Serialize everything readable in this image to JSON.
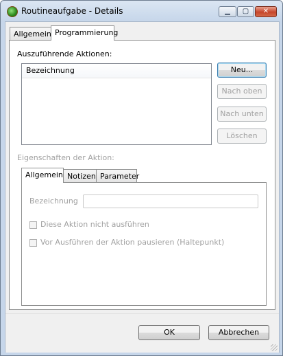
{
  "window": {
    "title": "Routineaufgabe - Details",
    "controls": {
      "minimize": "▁",
      "maximize": "▢",
      "close": "✕"
    }
  },
  "main_tabs": [
    {
      "label": "Allgemein",
      "active": false
    },
    {
      "label": "Programmierung",
      "active": true
    }
  ],
  "actions": {
    "label": "Auszuführende Aktionen:",
    "list_header": "Bezeichnung",
    "items": []
  },
  "buttons": {
    "new": "Neu...",
    "up": "Nach oben",
    "down": "Nach unten",
    "delete": "Löschen"
  },
  "properties": {
    "label": "Eigenschaften der Aktion:",
    "tabs": [
      {
        "label": "Allgemein",
        "active": true
      },
      {
        "label": "Notizen",
        "active": false
      },
      {
        "label": "Parameter",
        "active": false
      }
    ],
    "name_label": "Bezeichnung",
    "name_value": "",
    "checkbox_skip": "Diese Aktion nicht ausführen",
    "checkbox_pause": "Vor Ausführen der Aktion pausieren (Haltepunkt)"
  },
  "dialog_buttons": {
    "ok": "OK",
    "cancel": "Abbrechen"
  },
  "colors": {
    "title_bar": "#c6d6ea",
    "disabled_text": "#a0a0a0",
    "default_button_border": "#3c7fb1"
  }
}
